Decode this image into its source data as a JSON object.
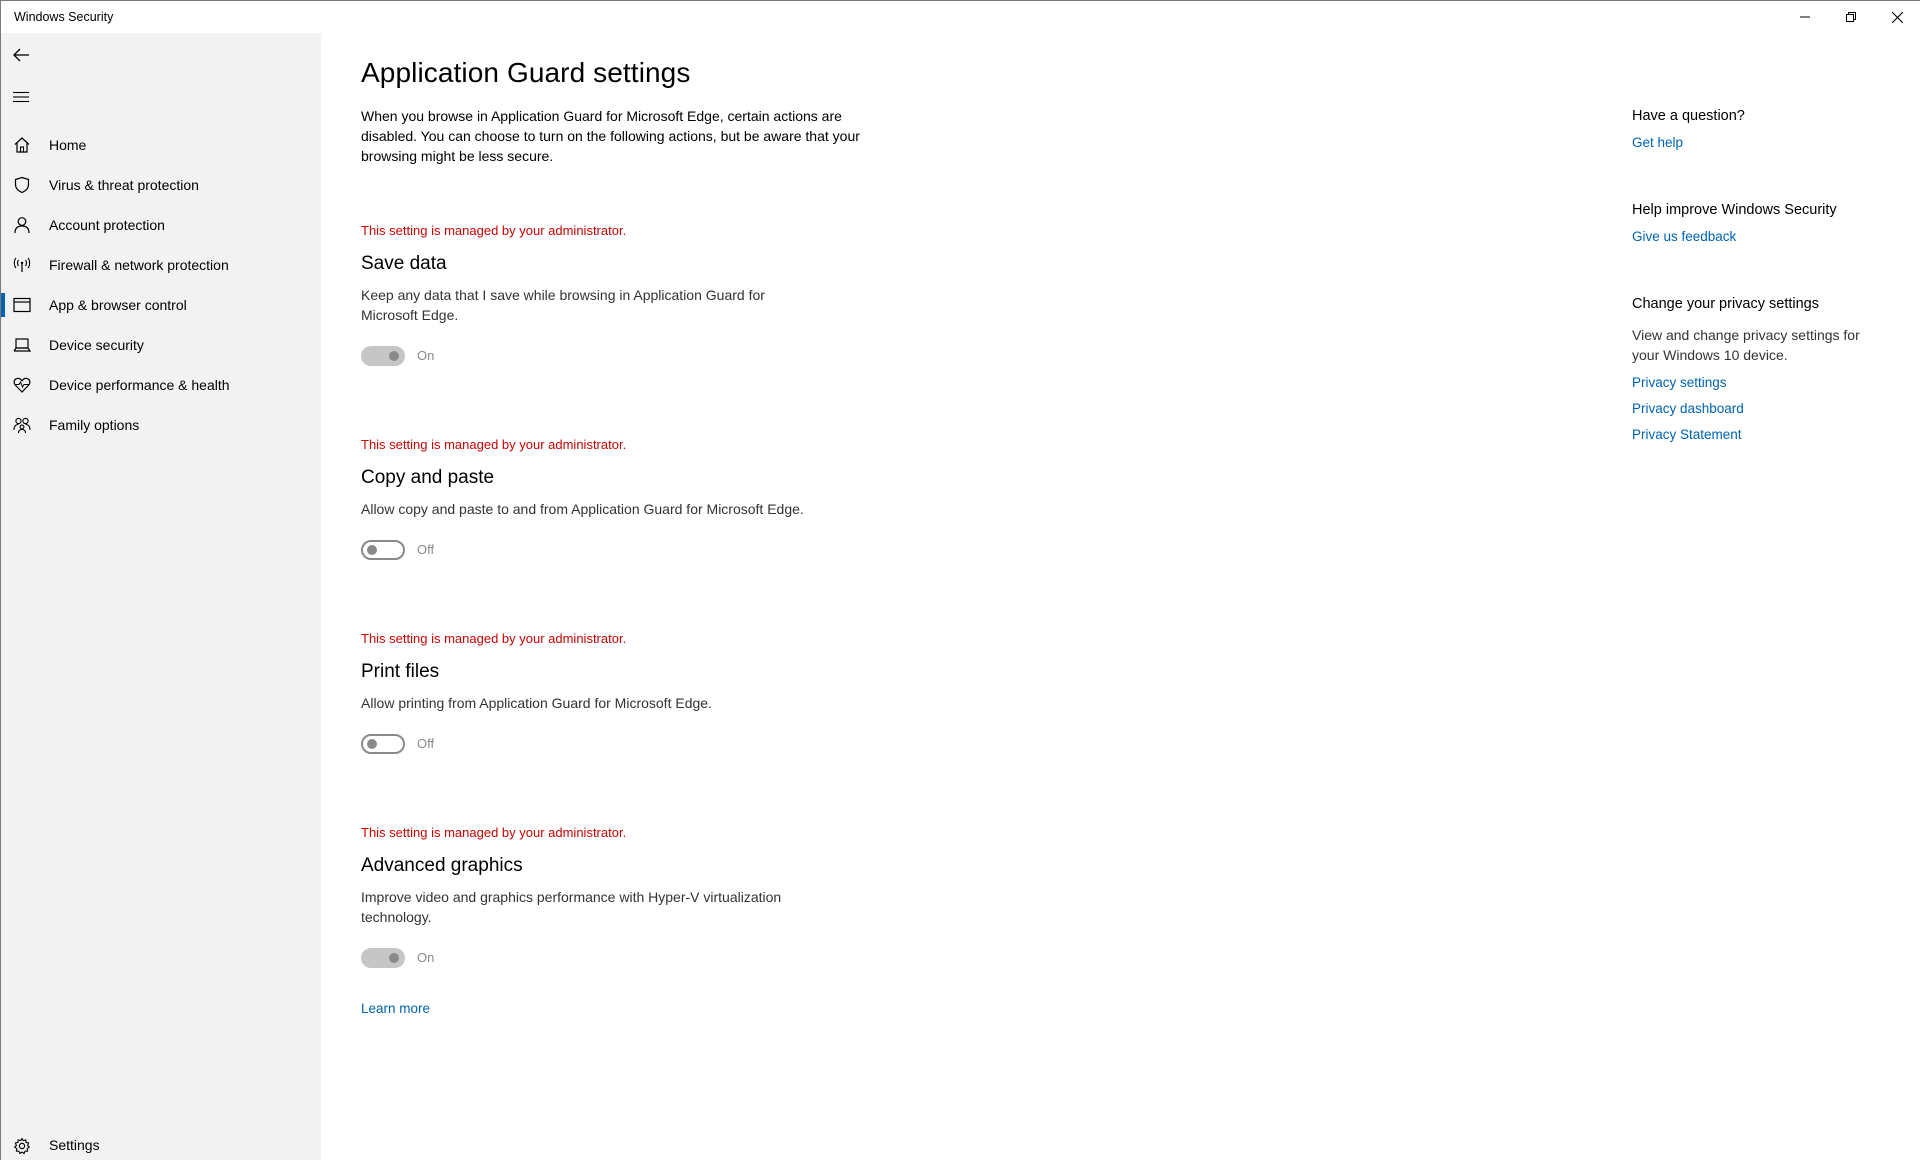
{
  "window": {
    "title": "Windows Security"
  },
  "sidebar": {
    "items": [
      {
        "label": "Home",
        "icon": "home-icon"
      },
      {
        "label": "Virus & threat protection",
        "icon": "shield-icon"
      },
      {
        "label": "Account protection",
        "icon": "person-icon"
      },
      {
        "label": "Firewall & network protection",
        "icon": "wireless-icon"
      },
      {
        "label": "App & browser control",
        "icon": "browser-window-icon",
        "selected": true
      },
      {
        "label": "Device security",
        "icon": "laptop-icon"
      },
      {
        "label": "Device performance & health",
        "icon": "heart-pulse-icon"
      },
      {
        "label": "Family options",
        "icon": "family-icon"
      }
    ],
    "settings_label": "Settings"
  },
  "main": {
    "title": "Application Guard settings",
    "description": "When you browse in Application Guard for Microsoft Edge, certain actions are disabled. You can choose to turn on the following actions, but be aware that your browsing might be less secure.",
    "settings": [
      {
        "admin_note": "This setting is managed by your administrator.",
        "title": "Save data",
        "description": "Keep any data that I save while browsing in Application Guard for Microsoft Edge.",
        "state": "On"
      },
      {
        "admin_note": "This setting is managed by your administrator.",
        "title": "Copy and paste",
        "description": "Allow copy and paste to and from Application Guard for Microsoft Edge.",
        "state": "Off"
      },
      {
        "admin_note": "This setting is managed by your administrator.",
        "title": "Print files",
        "description": "Allow printing from Application Guard for Microsoft Edge.",
        "state": "Off"
      },
      {
        "admin_note": "This setting is managed by your administrator.",
        "title": "Advanced graphics",
        "description": "Improve video and graphics performance with Hyper-V virtualization technology.",
        "state": "On"
      }
    ],
    "learn_more": "Learn more"
  },
  "right_panel": {
    "question_heading": "Have a question?",
    "get_help": "Get help",
    "improve_heading": "Help improve Windows Security",
    "feedback": "Give us feedback",
    "privacy_heading": "Change your privacy settings",
    "privacy_text": "View and change privacy settings for your Windows 10 device.",
    "privacy_settings": "Privacy settings",
    "privacy_dashboard": "Privacy dashboard",
    "privacy_statement": "Privacy Statement"
  },
  "colors": {
    "accent": "#0063b1",
    "admin_warning": "#c50500",
    "sidebar_bg": "#f2f2f2"
  }
}
